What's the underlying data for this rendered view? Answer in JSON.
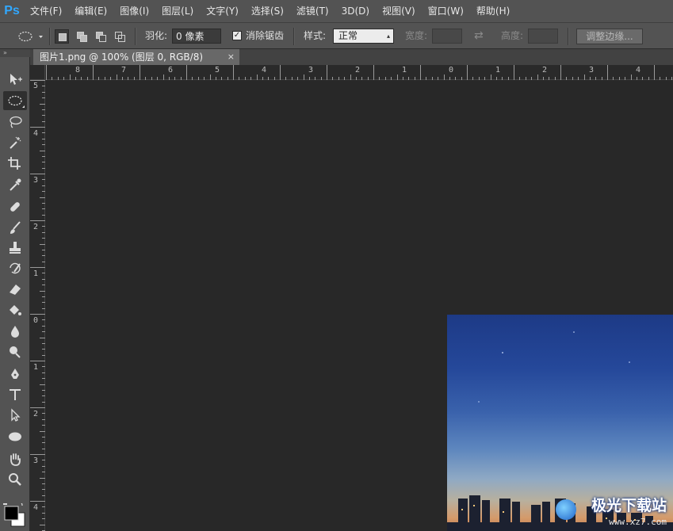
{
  "app": {
    "logo": "Ps"
  },
  "menu": [
    {
      "label": "文件(F)"
    },
    {
      "label": "编辑(E)"
    },
    {
      "label": "图像(I)"
    },
    {
      "label": "图层(L)"
    },
    {
      "label": "文字(Y)"
    },
    {
      "label": "选择(S)"
    },
    {
      "label": "滤镜(T)"
    },
    {
      "label": "3D(D)"
    },
    {
      "label": "视图(V)"
    },
    {
      "label": "窗口(W)"
    },
    {
      "label": "帮助(H)"
    }
  ],
  "options": {
    "feather_label": "羽化:",
    "feather_value": "0 像素",
    "antialias_label": "消除锯齿",
    "antialias_checked": true,
    "style_label": "样式:",
    "style_value": "正常",
    "width_label": "宽度:",
    "height_label": "高度:",
    "refine_edge_label": "调整边缘..."
  },
  "document": {
    "tab_title": "图片1.png @ 100% (图层 0, RGB/8)",
    "close_glyph": "×"
  },
  "rulers": {
    "h_labels": [
      "8",
      "7",
      "6",
      "5",
      "4",
      "3",
      "2",
      "1",
      "0",
      "1",
      "2",
      "3",
      "4"
    ],
    "v_labels": [
      "5",
      "4",
      "3",
      "2",
      "1",
      "0",
      "1",
      "2",
      "3",
      "4"
    ]
  },
  "watermark": {
    "text": "极光下载站",
    "sub": "www.xz7.com"
  },
  "colors": {
    "chrome": "#535353",
    "canvas_bg": "#282828",
    "accent": "#31a8ff",
    "foreground_swatch": "#000000",
    "background_swatch": "#ffffff"
  }
}
